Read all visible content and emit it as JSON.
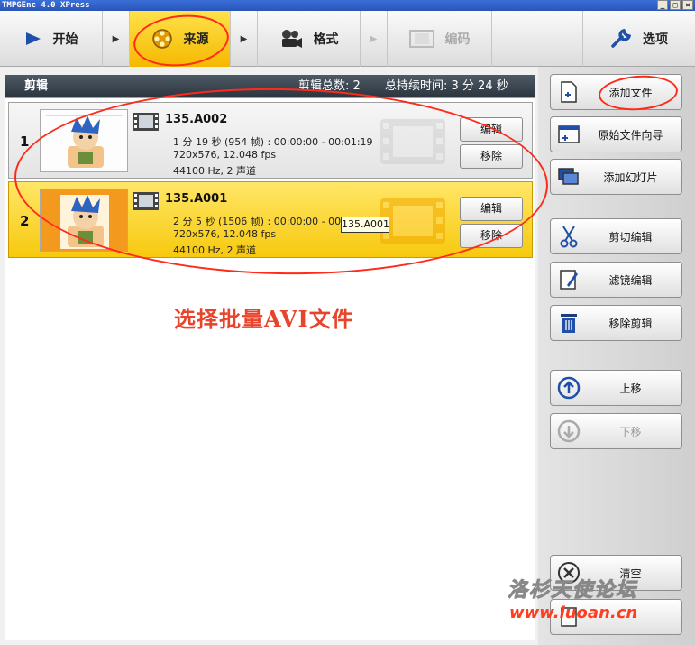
{
  "window": {
    "title": "TMPGEnc 4.0 XPress",
    "controls": [
      "_",
      "□",
      "×"
    ]
  },
  "toolbar": {
    "start_label": "开始",
    "source_label": "来源",
    "format_label": "格式",
    "encode_label": "编码",
    "options_label": "选项",
    "arrow_glyph": "▶"
  },
  "clips": {
    "header_title": "剪辑",
    "count_text": "剪辑总数: 2",
    "duration_text": "总持续时间: 3 分 24 秒",
    "items": [
      {
        "index": "1",
        "name": "135.A002",
        "line1": "1 分 19 秒 (954 帧) : 00:00:00 - 00:01:19",
        "line2": "720x576, 12.048 fps",
        "line3": "44100 Hz, 2 声道",
        "edit_label": "编辑",
        "remove_label": "移除"
      },
      {
        "index": "2",
        "name": "135.A001",
        "line1": "2 分 5 秒 (1506 帧) : 00:00:00 - 00:02:05",
        "line2": "720x576, 12.048 fps",
        "line3": "44100 Hz, 2 声道",
        "edit_label": "编辑",
        "remove_label": "移除"
      }
    ],
    "tooltip": "135.A001"
  },
  "annotation_text": "选择批量AVI文件",
  "sidebar": {
    "add_file": "添加文件",
    "source_wizard": "原始文件向导",
    "add_slideshow": "添加幻灯片",
    "cut_edit": "剪切编辑",
    "filter_edit": "滤镜编辑",
    "remove_clip": "移除剪辑",
    "move_up": "上移",
    "move_down": "下移",
    "clear": "清空"
  },
  "watermark": {
    "name": "洛杉天使论坛",
    "url": "www.luoan.cn"
  },
  "colors": {
    "accent_yellow": "#f7c90e",
    "header_dark": "#2c353e",
    "annotation_red": "#ff2a1a"
  }
}
